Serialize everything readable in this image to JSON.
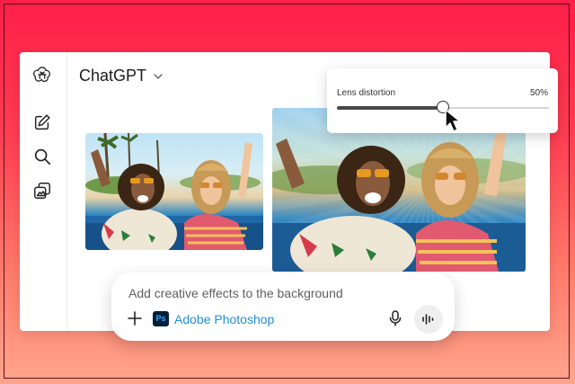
{
  "app": {
    "title": "ChatGPT"
  },
  "sidebar": {
    "items": [
      {
        "icon": "openai-logo-icon"
      },
      {
        "icon": "new-chat-icon"
      },
      {
        "icon": "search-icon"
      },
      {
        "icon": "library-icon"
      }
    ]
  },
  "slider": {
    "label": "Lens distortion",
    "value_text": "50%",
    "value": 0.5
  },
  "prompt": {
    "text": "Add creative effects to the background",
    "tool_name": "Adobe Photoshop",
    "tool_logo_text": "Ps"
  },
  "colors": {
    "background_top": "#ff1f48",
    "background_bottom": "#ffa58c",
    "link": "#1c8fe0",
    "ps_bg": "#001e36",
    "ps_fg": "#31a8ff"
  }
}
